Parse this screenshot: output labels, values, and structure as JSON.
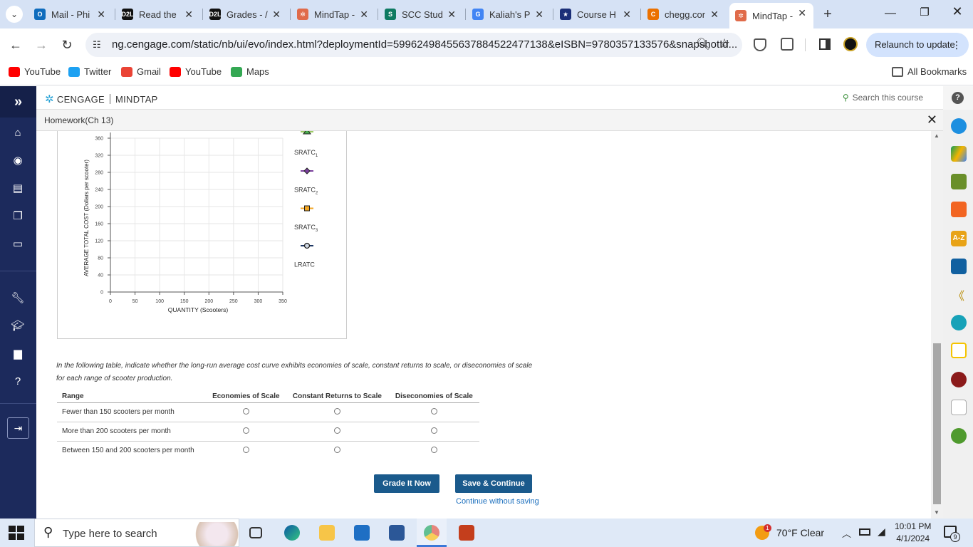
{
  "browser": {
    "tabs": [
      {
        "title": "Mail - Phi",
        "fav_color": "#0f6cbd",
        "fav_glyph": "O"
      },
      {
        "title": "Read the",
        "fav_color": "#111111",
        "fav_glyph": "D2L"
      },
      {
        "title": "Grades - /",
        "fav_color": "#111111",
        "fav_glyph": "D2L"
      },
      {
        "title": "MindTap -",
        "fav_color": "#e06b4a",
        "fav_glyph": "✲"
      },
      {
        "title": "SCC Stud",
        "fav_color": "#0e7a62",
        "fav_glyph": "S"
      },
      {
        "title": "Kaliah's P",
        "fav_color": "#4285f4",
        "fav_glyph": "G"
      },
      {
        "title": "Course H",
        "fav_color": "#1b2f78",
        "fav_glyph": "★"
      },
      {
        "title": "chegg.cor",
        "fav_color": "#eb7100",
        "fav_glyph": "C"
      },
      {
        "title": "MindTap -",
        "fav_color": "#e06b4a",
        "fav_glyph": "✲"
      }
    ],
    "url": "ng.cengage.com/static/nb/ui/evo/index.html?deploymentId=59962498455637884522477138&eISBN=9780357133576&snapshotId...",
    "relaunch_label": "Relaunch to update",
    "bookmarks": [
      {
        "label": "YouTube",
        "icon": "youtube-icon",
        "color": "#ff0000"
      },
      {
        "label": "Twitter",
        "icon": "twitter-icon",
        "color": "#1da1f2"
      },
      {
        "label": "Gmail",
        "icon": "gmail-icon",
        "color": "#ea4335"
      },
      {
        "label": "YouTube",
        "icon": "youtube-icon",
        "color": "#ff0000"
      },
      {
        "label": "Maps",
        "icon": "maps-icon",
        "color": "#34a853"
      }
    ],
    "all_bookmarks_label": "All Bookmarks"
  },
  "app": {
    "brand_left": "CENGAGE",
    "brand_right": "MINDTAP",
    "search_label": "Search this course",
    "homework_title": "Homework(Ch 13)",
    "accent": "#1a5a8c"
  },
  "chart_data": {
    "type": "line",
    "xlabel": "QUANTITY (Scooters)",
    "ylabel": "AVERAGE TOTAL COST (Dollars per scooter)",
    "xlim": [
      0,
      350
    ],
    "ylim": [
      0,
      360
    ],
    "xticks": [
      0,
      50,
      100,
      150,
      200,
      250,
      300,
      350
    ],
    "yticks": [
      0,
      40,
      80,
      120,
      160,
      200,
      240,
      280,
      320,
      360
    ],
    "grid": true,
    "series": [],
    "legend_placement": "right",
    "tools": [
      {
        "name": "SRATC",
        "sub": "1",
        "color": "#7b3f9e",
        "marker": "diamond"
      },
      {
        "name": "SRATC",
        "sub": "2",
        "color": "#f2a623",
        "marker": "square"
      },
      {
        "name": "SRATC",
        "sub": "3",
        "color": "#1f3864",
        "marker": "circle"
      },
      {
        "name": "LRATC",
        "sub": "",
        "color": "#000000",
        "marker": "none"
      }
    ],
    "top_marker_color": "#4caf50"
  },
  "question": {
    "instructions": "In the following table, indicate whether the long-run average cost curve exhibits economies of scale, constant returns to scale, or diseconomies of scale for each range of scooter production.",
    "headers": [
      "Range",
      "Economies of Scale",
      "Constant Returns to Scale",
      "Diseconomies of Scale"
    ],
    "rows": [
      "Fewer than 150 scooters per month",
      "More than 200 scooters per month",
      "Between 150 and 200 scooters per month"
    ]
  },
  "actions": {
    "grade_label": "Grade It Now",
    "save_label": "Save & Continue",
    "continue_label": "Continue without saving"
  },
  "taskbar": {
    "search_placeholder": "Type here to search",
    "weather": "70°F  Clear",
    "weather_badge": "1",
    "time": "10:01 PM",
    "date": "4/1/2024",
    "notif_count": "9"
  }
}
